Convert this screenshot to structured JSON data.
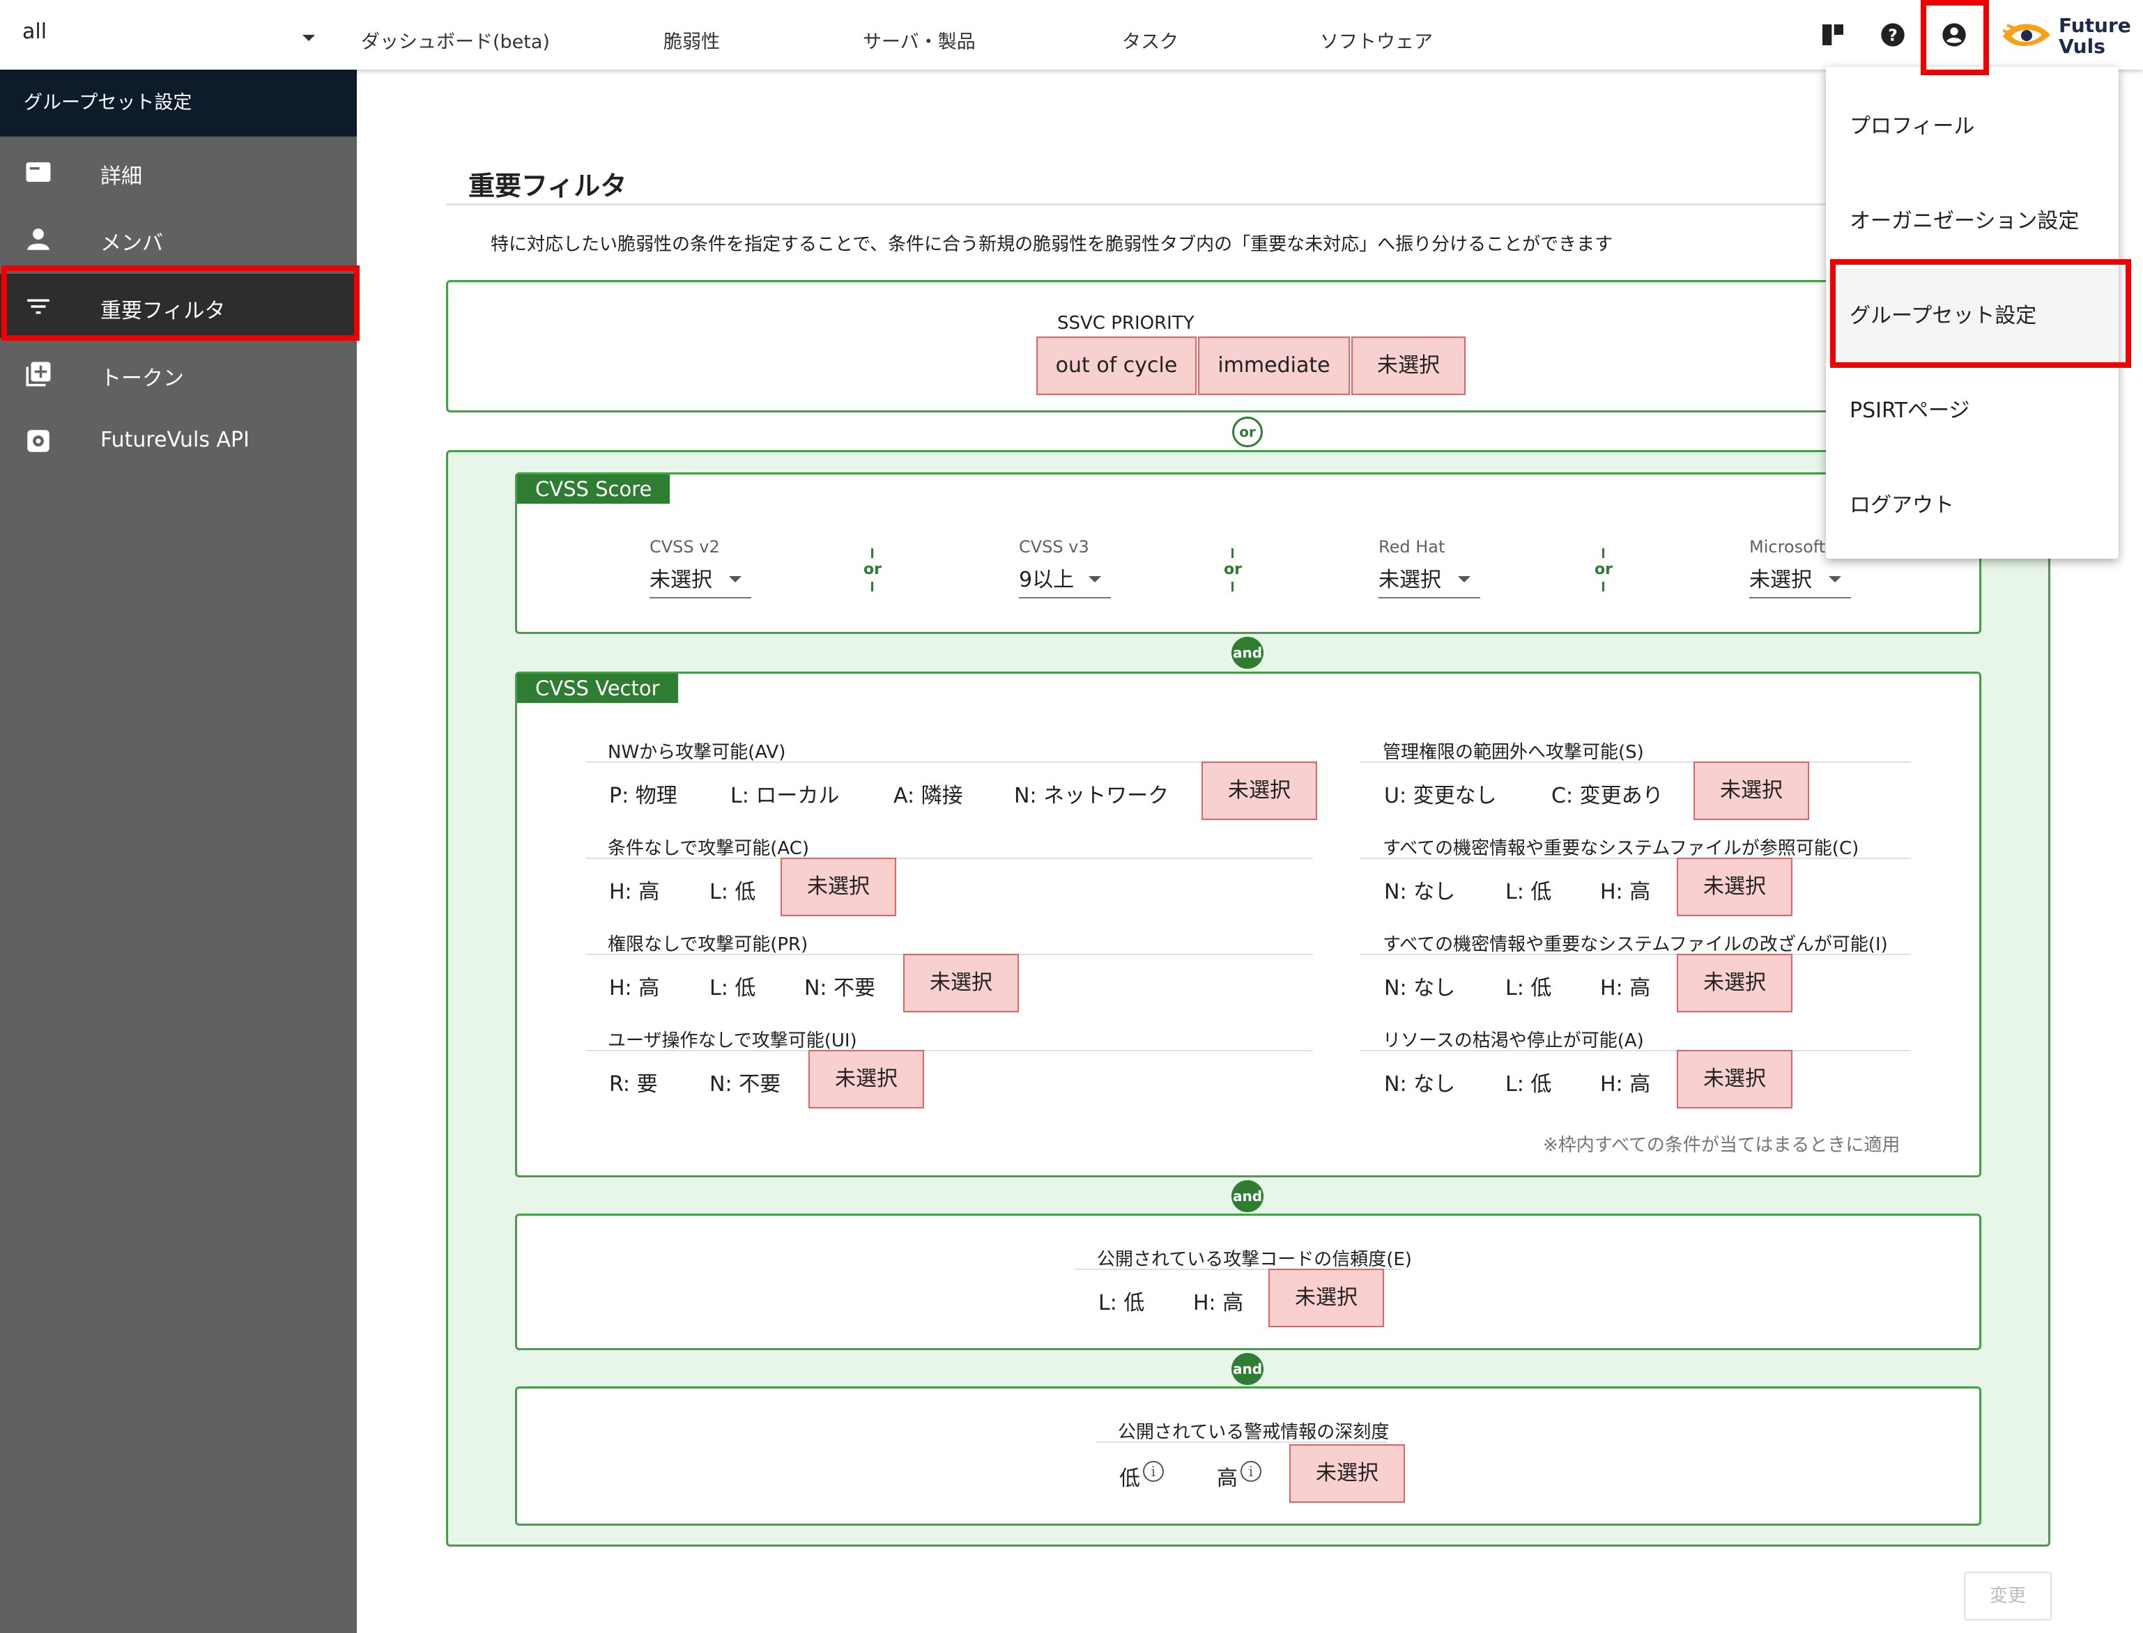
{
  "topbar": {
    "group_select": "all",
    "nav": [
      "ダッシュボード(beta)",
      "脆弱性",
      "サーバ・製品",
      "タスク",
      "ソフトウェア"
    ],
    "icons": [
      "board-icon",
      "help-icon",
      "account-icon"
    ],
    "logo_line1": "Future",
    "logo_line2": "Vuls"
  },
  "sidebar": {
    "header": "グループセット設定",
    "items": [
      {
        "label": "詳細",
        "icon": "details-icon"
      },
      {
        "label": "メンバ",
        "icon": "person-icon"
      },
      {
        "label": "重要フィルタ",
        "icon": "filter-icon"
      },
      {
        "label": "トークン",
        "icon": "add-box-icon"
      },
      {
        "label": "FutureVuls API",
        "icon": "settings-icon"
      }
    ]
  },
  "main": {
    "title": "重要フィルタ",
    "description": "特に対応したい脆弱性の条件を指定することで、条件に合う新規の脆弱性を脆弱性タブ内の「重要な未対応」へ振り分けることができます",
    "ssvc": {
      "label": "SSVC PRIORITY",
      "options": [
        "out of cycle",
        "immediate",
        "未選択"
      ]
    },
    "or_label": "or",
    "and_label": "and",
    "cvss_score": {
      "tag": "CVSS Score",
      "fields": [
        {
          "label": "CVSS v2",
          "value": "未選択"
        },
        {
          "label": "CVSS v3",
          "value": "9以上"
        },
        {
          "label": "Red Hat",
          "value": "未選択"
        },
        {
          "label": "Microsoft",
          "value": "未選択"
        }
      ]
    },
    "cvss_vector": {
      "tag": "CVSS Vector",
      "left": [
        {
          "label": "NWから攻撃可能(AV)",
          "options": [
            "P: 物理",
            "L: ローカル",
            "A: 隣接",
            "N: ネットワーク"
          ],
          "unselected": "未選択"
        },
        {
          "label": "条件なしで攻撃可能(AC)",
          "options": [
            "H: 高",
            "L: 低"
          ],
          "unselected": "未選択"
        },
        {
          "label": "権限なしで攻撃可能(PR)",
          "options": [
            "H: 高",
            "L: 低",
            "N: 不要"
          ],
          "unselected": "未選択"
        },
        {
          "label": "ユーザ操作なしで攻撃可能(UI)",
          "options": [
            "R: 要",
            "N: 不要"
          ],
          "unselected": "未選択"
        }
      ],
      "right": [
        {
          "label": "管理権限の範囲外へ攻撃可能(S)",
          "options": [
            "U: 変更なし",
            "C: 変更あり"
          ],
          "unselected": "未選択"
        },
        {
          "label": "すべての機密情報や重要なシステムファイルが参照可能(C)",
          "options": [
            "N: なし",
            "L: 低",
            "H: 高"
          ],
          "unselected": "未選択"
        },
        {
          "label": "すべての機密情報や重要なシステムファイルの改ざんが可能(I)",
          "options": [
            "N: なし",
            "L: 低",
            "H: 高"
          ],
          "unselected": "未選択"
        },
        {
          "label": "リソースの枯渇や停止が可能(A)",
          "options": [
            "N: なし",
            "L: 低",
            "H: 高"
          ],
          "unselected": "未選択"
        }
      ],
      "note": "※枠内すべての条件が当てはまるときに適用"
    },
    "exploit": {
      "label": "公開されている攻撃コードの信頼度(E)",
      "options": [
        "L: 低",
        "H: 高"
      ],
      "unselected": "未選択"
    },
    "alert": {
      "label": "公開されている警戒情報の深刻度",
      "options": [
        "低",
        "高"
      ],
      "unselected": "未選択"
    },
    "submit": "変更"
  },
  "account_menu": {
    "items": [
      "プロフィール",
      "オーガニゼーション設定",
      "グループセット設定",
      "PSIRTページ",
      "ログアウト"
    ]
  }
}
